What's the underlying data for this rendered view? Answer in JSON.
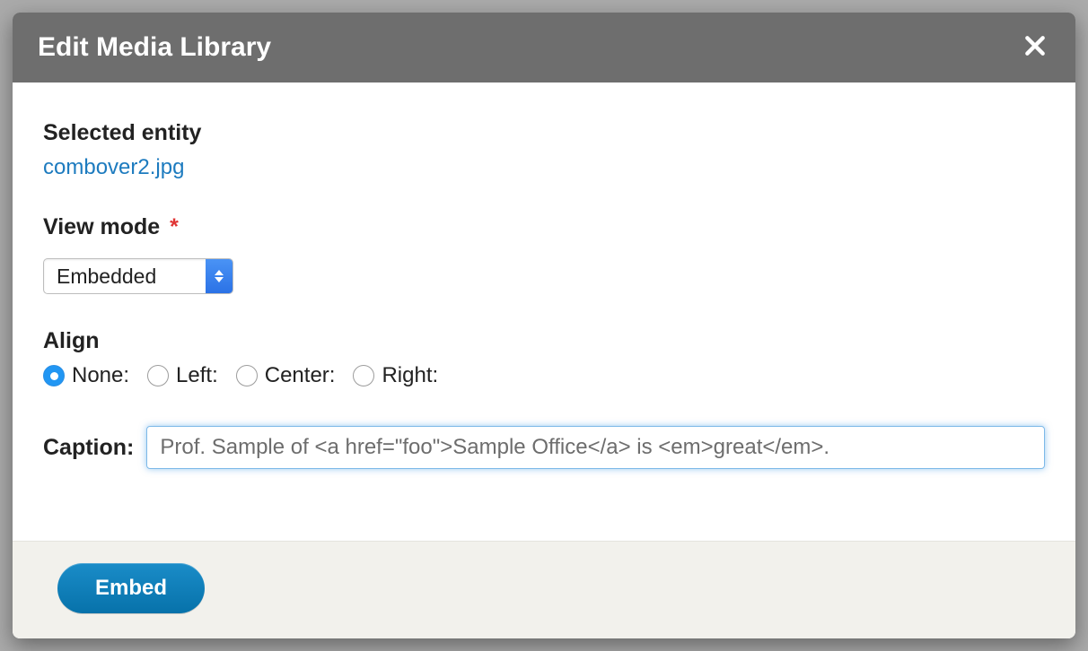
{
  "dialog": {
    "title": "Edit Media Library",
    "selected_label": "Selected entity",
    "selected_entity": "combover2.jpg",
    "viewmode_label": "View mode",
    "viewmode_required_mark": "*",
    "viewmode_value": "Embedded",
    "align_label": "Align",
    "align_options": [
      "None:",
      "Left:",
      "Center:",
      "Right:"
    ],
    "align_selected_index": 0,
    "caption_label": "Caption:",
    "caption_value": "Prof. Sample of <a href=\"foo\">Sample Office</a> is <em>great</em>.",
    "embed_button": "Embed"
  }
}
